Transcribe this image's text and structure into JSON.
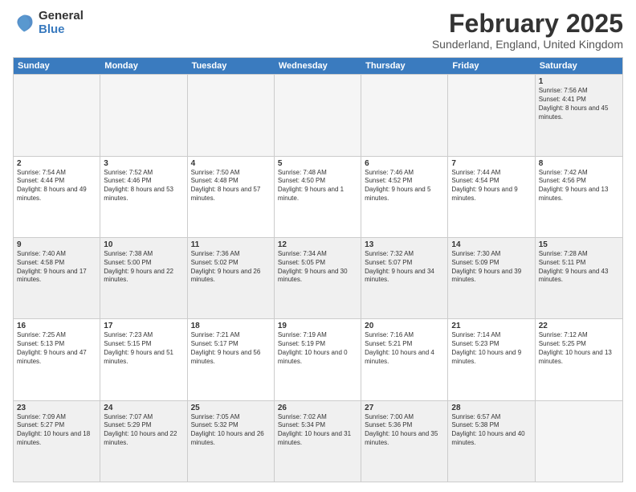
{
  "logo": {
    "general": "General",
    "blue": "Blue"
  },
  "title": "February 2025",
  "location": "Sunderland, England, United Kingdom",
  "days": [
    "Sunday",
    "Monday",
    "Tuesday",
    "Wednesday",
    "Thursday",
    "Friday",
    "Saturday"
  ],
  "weeks": [
    [
      {
        "num": "",
        "info": "",
        "empty": true
      },
      {
        "num": "",
        "info": "",
        "empty": true
      },
      {
        "num": "",
        "info": "",
        "empty": true
      },
      {
        "num": "",
        "info": "",
        "empty": true
      },
      {
        "num": "",
        "info": "",
        "empty": true
      },
      {
        "num": "",
        "info": "",
        "empty": true
      },
      {
        "num": "1",
        "info": "Sunrise: 7:56 AM\nSunset: 4:41 PM\nDaylight: 8 hours and 45 minutes.",
        "empty": false
      }
    ],
    [
      {
        "num": "2",
        "info": "Sunrise: 7:54 AM\nSunset: 4:44 PM\nDaylight: 8 hours and 49 minutes.",
        "empty": false
      },
      {
        "num": "3",
        "info": "Sunrise: 7:52 AM\nSunset: 4:46 PM\nDaylight: 8 hours and 53 minutes.",
        "empty": false
      },
      {
        "num": "4",
        "info": "Sunrise: 7:50 AM\nSunset: 4:48 PM\nDaylight: 8 hours and 57 minutes.",
        "empty": false
      },
      {
        "num": "5",
        "info": "Sunrise: 7:48 AM\nSunset: 4:50 PM\nDaylight: 9 hours and 1 minute.",
        "empty": false
      },
      {
        "num": "6",
        "info": "Sunrise: 7:46 AM\nSunset: 4:52 PM\nDaylight: 9 hours and 5 minutes.",
        "empty": false
      },
      {
        "num": "7",
        "info": "Sunrise: 7:44 AM\nSunset: 4:54 PM\nDaylight: 9 hours and 9 minutes.",
        "empty": false
      },
      {
        "num": "8",
        "info": "Sunrise: 7:42 AM\nSunset: 4:56 PM\nDaylight: 9 hours and 13 minutes.",
        "empty": false
      }
    ],
    [
      {
        "num": "9",
        "info": "Sunrise: 7:40 AM\nSunset: 4:58 PM\nDaylight: 9 hours and 17 minutes.",
        "empty": false
      },
      {
        "num": "10",
        "info": "Sunrise: 7:38 AM\nSunset: 5:00 PM\nDaylight: 9 hours and 22 minutes.",
        "empty": false
      },
      {
        "num": "11",
        "info": "Sunrise: 7:36 AM\nSunset: 5:02 PM\nDaylight: 9 hours and 26 minutes.",
        "empty": false
      },
      {
        "num": "12",
        "info": "Sunrise: 7:34 AM\nSunset: 5:05 PM\nDaylight: 9 hours and 30 minutes.",
        "empty": false
      },
      {
        "num": "13",
        "info": "Sunrise: 7:32 AM\nSunset: 5:07 PM\nDaylight: 9 hours and 34 minutes.",
        "empty": false
      },
      {
        "num": "14",
        "info": "Sunrise: 7:30 AM\nSunset: 5:09 PM\nDaylight: 9 hours and 39 minutes.",
        "empty": false
      },
      {
        "num": "15",
        "info": "Sunrise: 7:28 AM\nSunset: 5:11 PM\nDaylight: 9 hours and 43 minutes.",
        "empty": false
      }
    ],
    [
      {
        "num": "16",
        "info": "Sunrise: 7:25 AM\nSunset: 5:13 PM\nDaylight: 9 hours and 47 minutes.",
        "empty": false
      },
      {
        "num": "17",
        "info": "Sunrise: 7:23 AM\nSunset: 5:15 PM\nDaylight: 9 hours and 51 minutes.",
        "empty": false
      },
      {
        "num": "18",
        "info": "Sunrise: 7:21 AM\nSunset: 5:17 PM\nDaylight: 9 hours and 56 minutes.",
        "empty": false
      },
      {
        "num": "19",
        "info": "Sunrise: 7:19 AM\nSunset: 5:19 PM\nDaylight: 10 hours and 0 minutes.",
        "empty": false
      },
      {
        "num": "20",
        "info": "Sunrise: 7:16 AM\nSunset: 5:21 PM\nDaylight: 10 hours and 4 minutes.",
        "empty": false
      },
      {
        "num": "21",
        "info": "Sunrise: 7:14 AM\nSunset: 5:23 PM\nDaylight: 10 hours and 9 minutes.",
        "empty": false
      },
      {
        "num": "22",
        "info": "Sunrise: 7:12 AM\nSunset: 5:25 PM\nDaylight: 10 hours and 13 minutes.",
        "empty": false
      }
    ],
    [
      {
        "num": "23",
        "info": "Sunrise: 7:09 AM\nSunset: 5:27 PM\nDaylight: 10 hours and 18 minutes.",
        "empty": false
      },
      {
        "num": "24",
        "info": "Sunrise: 7:07 AM\nSunset: 5:29 PM\nDaylight: 10 hours and 22 minutes.",
        "empty": false
      },
      {
        "num": "25",
        "info": "Sunrise: 7:05 AM\nSunset: 5:32 PM\nDaylight: 10 hours and 26 minutes.",
        "empty": false
      },
      {
        "num": "26",
        "info": "Sunrise: 7:02 AM\nSunset: 5:34 PM\nDaylight: 10 hours and 31 minutes.",
        "empty": false
      },
      {
        "num": "27",
        "info": "Sunrise: 7:00 AM\nSunset: 5:36 PM\nDaylight: 10 hours and 35 minutes.",
        "empty": false
      },
      {
        "num": "28",
        "info": "Sunrise: 6:57 AM\nSunset: 5:38 PM\nDaylight: 10 hours and 40 minutes.",
        "empty": false
      },
      {
        "num": "",
        "info": "",
        "empty": true
      }
    ]
  ]
}
